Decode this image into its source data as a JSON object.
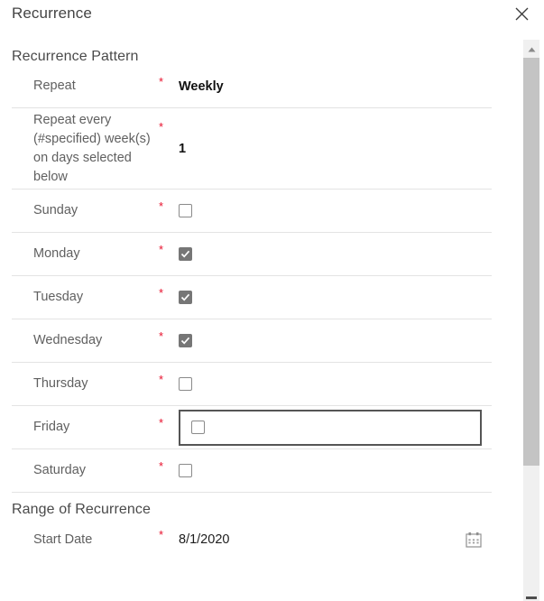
{
  "dialog": {
    "title": "Recurrence",
    "close_icon": "close-icon"
  },
  "sections": [
    {
      "heading": "Recurrence Pattern"
    },
    {
      "heading": "Range of Recurrence"
    }
  ],
  "pattern": {
    "heading": "Recurrence Pattern",
    "repeat": {
      "label": "Repeat",
      "required_mark": "*",
      "value": "Weekly"
    },
    "interval": {
      "label": "Repeat every (#specified) week(s) on days selected below",
      "required_mark": "*",
      "value": "1"
    },
    "days": [
      {
        "label": "Sunday",
        "required_mark": "*",
        "checked": false,
        "focused": false
      },
      {
        "label": "Monday",
        "required_mark": "*",
        "checked": true,
        "focused": false
      },
      {
        "label": "Tuesday",
        "required_mark": "*",
        "checked": true,
        "focused": false
      },
      {
        "label": "Wednesday",
        "required_mark": "*",
        "checked": true,
        "focused": false
      },
      {
        "label": "Thursday",
        "required_mark": "*",
        "checked": false,
        "focused": false
      },
      {
        "label": "Friday",
        "required_mark": "*",
        "checked": false,
        "focused": true
      },
      {
        "label": "Saturday",
        "required_mark": "*",
        "checked": false,
        "focused": false
      }
    ]
  },
  "range": {
    "heading": "Range of Recurrence",
    "start_date": {
      "label": "Start Date",
      "required_mark": "*",
      "value": "8/1/2020",
      "icon": "calendar-icon"
    }
  },
  "scrollbar": {
    "up_arrow_icon": "chevron-up-icon"
  },
  "colors": {
    "required_red": "#e8112d",
    "checkbox_checked": "#767676",
    "divider": "#e3e3e3",
    "focus_border": "#555555",
    "scrollbar_thumb": "#c4c4c4"
  }
}
